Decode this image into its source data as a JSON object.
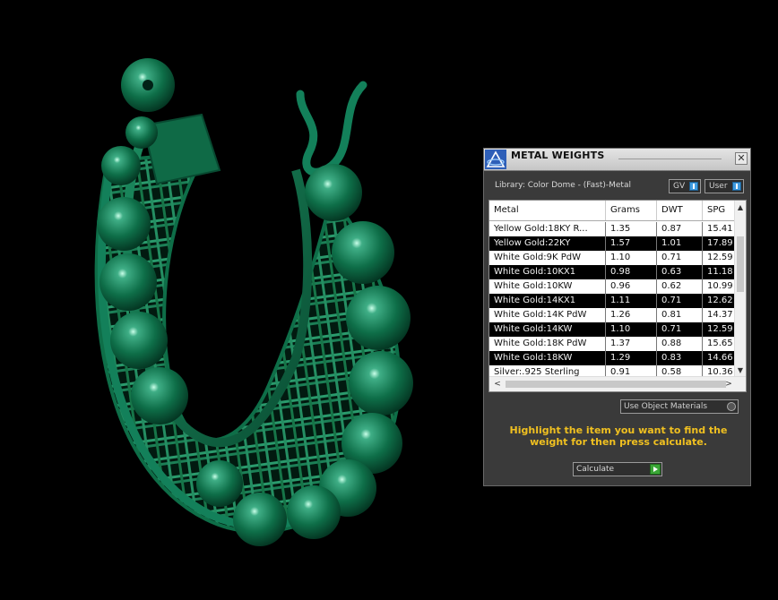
{
  "panel": {
    "title": "METAL WEIGHTS",
    "close_glyph": "✕",
    "library_label": "Library: Color Dome - (Fast)-Metal",
    "toggle_gv": "GV",
    "toggle_user": "User",
    "columns": [
      "Metal",
      "Grams",
      "DWT",
      "SPG"
    ],
    "rows": [
      [
        "Yellow Gold:18KY R...",
        "1.35",
        "0.87",
        "15.41"
      ],
      [
        "Yellow Gold:22KY",
        "1.57",
        "1.01",
        "17.89"
      ],
      [
        "White Gold:9K PdW",
        "1.10",
        "0.71",
        "12.59"
      ],
      [
        "White Gold:10KX1",
        "0.98",
        "0.63",
        "11.18"
      ],
      [
        "White Gold:10KW",
        "0.96",
        "0.62",
        "10.99"
      ],
      [
        "White Gold:14KX1",
        "1.11",
        "0.71",
        "12.62"
      ],
      [
        "White Gold:14K PdW",
        "1.26",
        "0.81",
        "14.37"
      ],
      [
        "White Gold:14KW",
        "1.10",
        "0.71",
        "12.59"
      ],
      [
        "White Gold:18K PdW",
        "1.37",
        "0.88",
        "15.65"
      ],
      [
        "White Gold:18KW",
        "1.29",
        "0.83",
        "14.66"
      ],
      [
        "Silver:.925 Sterling",
        "0.91",
        "0.58",
        "10.36"
      ]
    ],
    "use_object_materials": "Use Object Materials",
    "instruction": "Highlight the item you want to find the weight for then press calculate.",
    "calculate_label": "Calculate",
    "scroll_up": "▲",
    "scroll_down": "▼",
    "scroll_left": "<",
    "scroll_right": ">"
  },
  "colors": {
    "model_green": "#0e6e48",
    "instruction_yellow": "#f0c020",
    "toggle_blue": "#3f9be0"
  }
}
